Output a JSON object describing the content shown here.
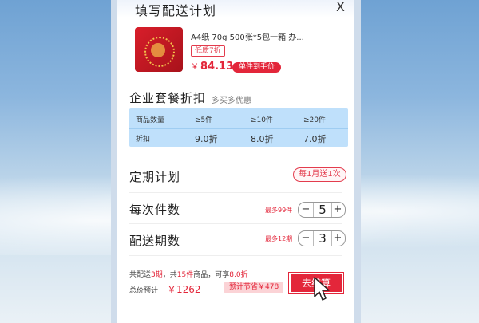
{
  "dialog": {
    "title": "填写配送计划",
    "close": "X"
  },
  "product": {
    "name": "A4纸 70g 500张*5包一箱 办...",
    "discount_tag": "低质7折",
    "currency": "￥",
    "price": "84.13",
    "unit_price_badge": "单件到手价"
  },
  "enterprise": {
    "title": "企业套餐折扣",
    "subtitle": "多买多优惠",
    "table": {
      "header": [
        "商品数量",
        "≥5件",
        "≥10件",
        "≥20件"
      ],
      "row": [
        "折扣",
        "9.0折",
        "8.0折",
        "7.0折"
      ]
    }
  },
  "schedule": {
    "title": "定期计划",
    "rule_badge": "每1月送1次"
  },
  "per_delivery": {
    "title": "每次件数",
    "max_note": "最多99件",
    "value": "5",
    "minus": "−",
    "plus": "+"
  },
  "periods": {
    "title": "配送期数",
    "max_note": "最多12期",
    "value": "3",
    "minus": "−",
    "plus": "+"
  },
  "summary": {
    "p1": "共配送",
    "periods_val": "3期",
    "p2": "，共",
    "items_val": "15件",
    "p3": "商品，可享",
    "discount_val": "8.0折",
    "total_label": "总价预计",
    "total_price": "￥1262",
    "save_badge": "预计节省￥478"
  },
  "checkout": {
    "label": "去结算"
  },
  "colors": {
    "accent": "#e3263a",
    "table_bg": "#bfe0fb"
  }
}
